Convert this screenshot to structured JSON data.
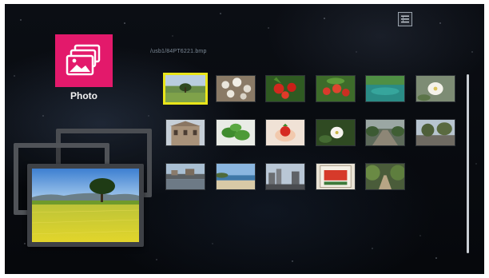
{
  "app": {
    "label": "Photo",
    "icon": "photo-app-icon",
    "accent_color": "#e3196b"
  },
  "header": {
    "current_path": "/usb1/84PT6221.bmp",
    "top_right_icon": "menu-list-icon"
  },
  "preview": {
    "description_icon": "stacked-photo-frames"
  },
  "browser": {
    "selected_index": 0,
    "selection_color": "#e9e51a",
    "thumbnails": [
      {
        "name": "thumb-field-tree"
      },
      {
        "name": "thumb-white-blossoms"
      },
      {
        "name": "thumb-strawberries"
      },
      {
        "name": "thumb-strawberries-closeup"
      },
      {
        "name": "thumb-teal-lake"
      },
      {
        "name": "thumb-white-flower"
      },
      {
        "name": "thumb-stone-building"
      },
      {
        "name": "thumb-green-leaves"
      },
      {
        "name": "thumb-hand-strawberry"
      },
      {
        "name": "thumb-white-bloom"
      },
      {
        "name": "thumb-garden-path"
      },
      {
        "name": "thumb-tree-street"
      },
      {
        "name": "thumb-harbor"
      },
      {
        "name": "thumb-beach"
      },
      {
        "name": "thumb-city-street"
      },
      {
        "name": "thumb-framed-poster"
      },
      {
        "name": "thumb-forest-path"
      }
    ]
  },
  "scrollbar": {
    "position_fraction": 1.0
  }
}
